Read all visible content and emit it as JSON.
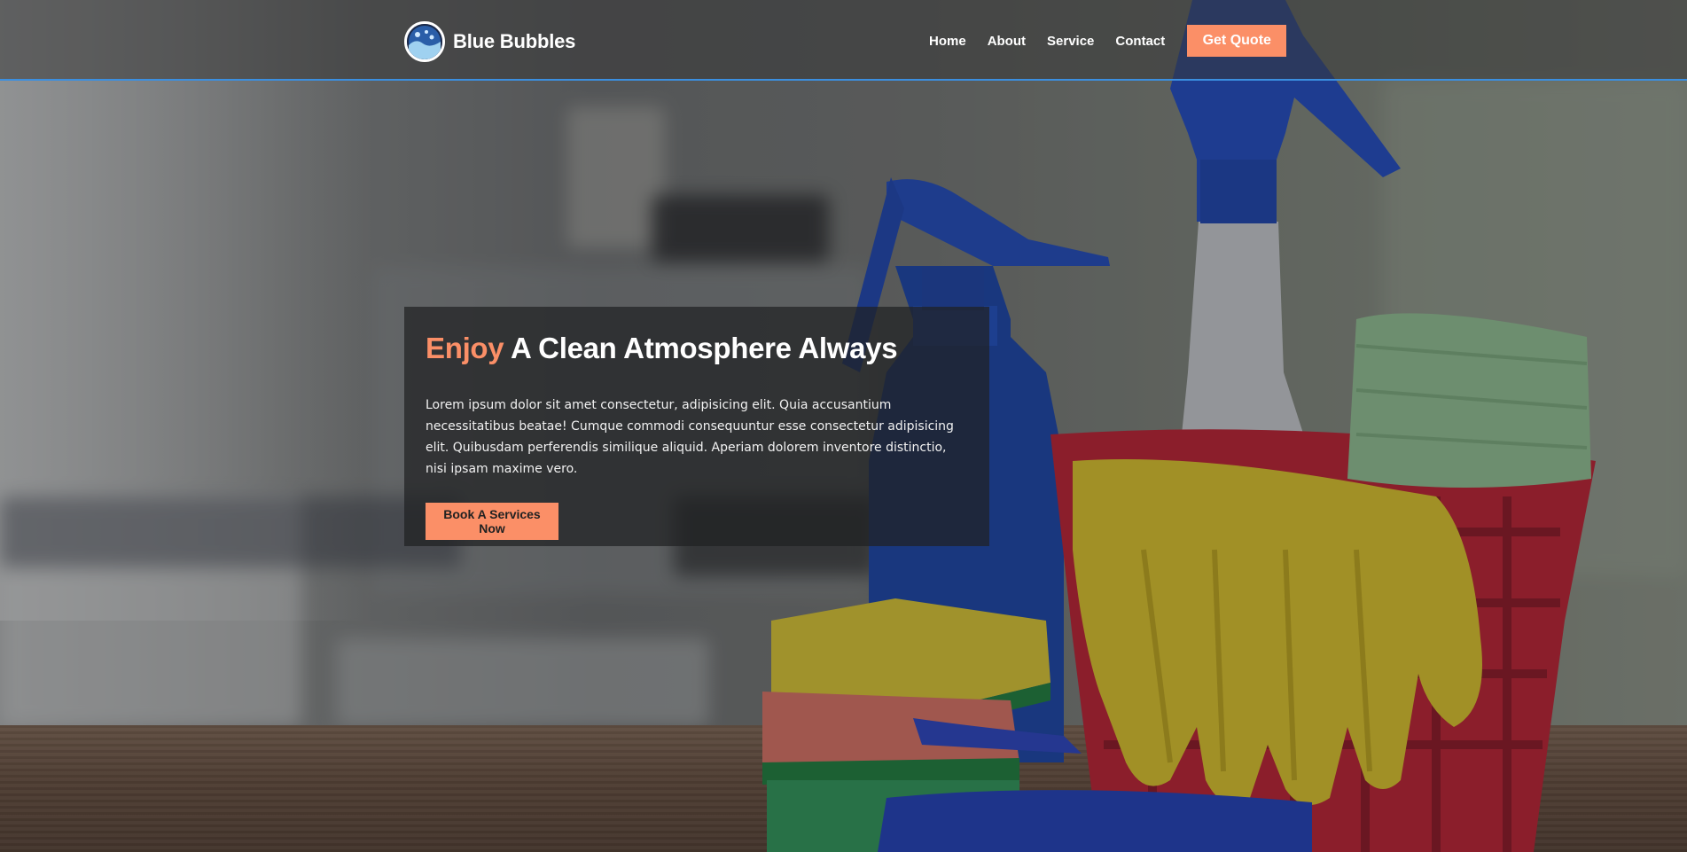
{
  "header": {
    "brand_name": "Blue Bubbles",
    "nav": {
      "home": "Home",
      "about": "About",
      "service": "Service",
      "contact": "Contact"
    },
    "quote_button": "Get Quote"
  },
  "hero": {
    "headline_accent": "Enjoy",
    "headline_rest": " A Clean Atmosphere Always",
    "body": "Lorem ipsum dolor sit amet consectetur, adipisicing elit. Quia accusantium necessitatibus beatae! Cumque commodi consequuntur esse consectetur adipisicing elit. Quibusdam perferendis similique aliquid. Aperiam dolorem inventore distinctio, nisi ipsam maxime vero.",
    "cta_button": "Book A Services Now"
  },
  "colors": {
    "accent": "#fb8f67",
    "header_border": "#3b8fe0"
  },
  "icons": {
    "logo": "bubbles-logo-icon"
  }
}
